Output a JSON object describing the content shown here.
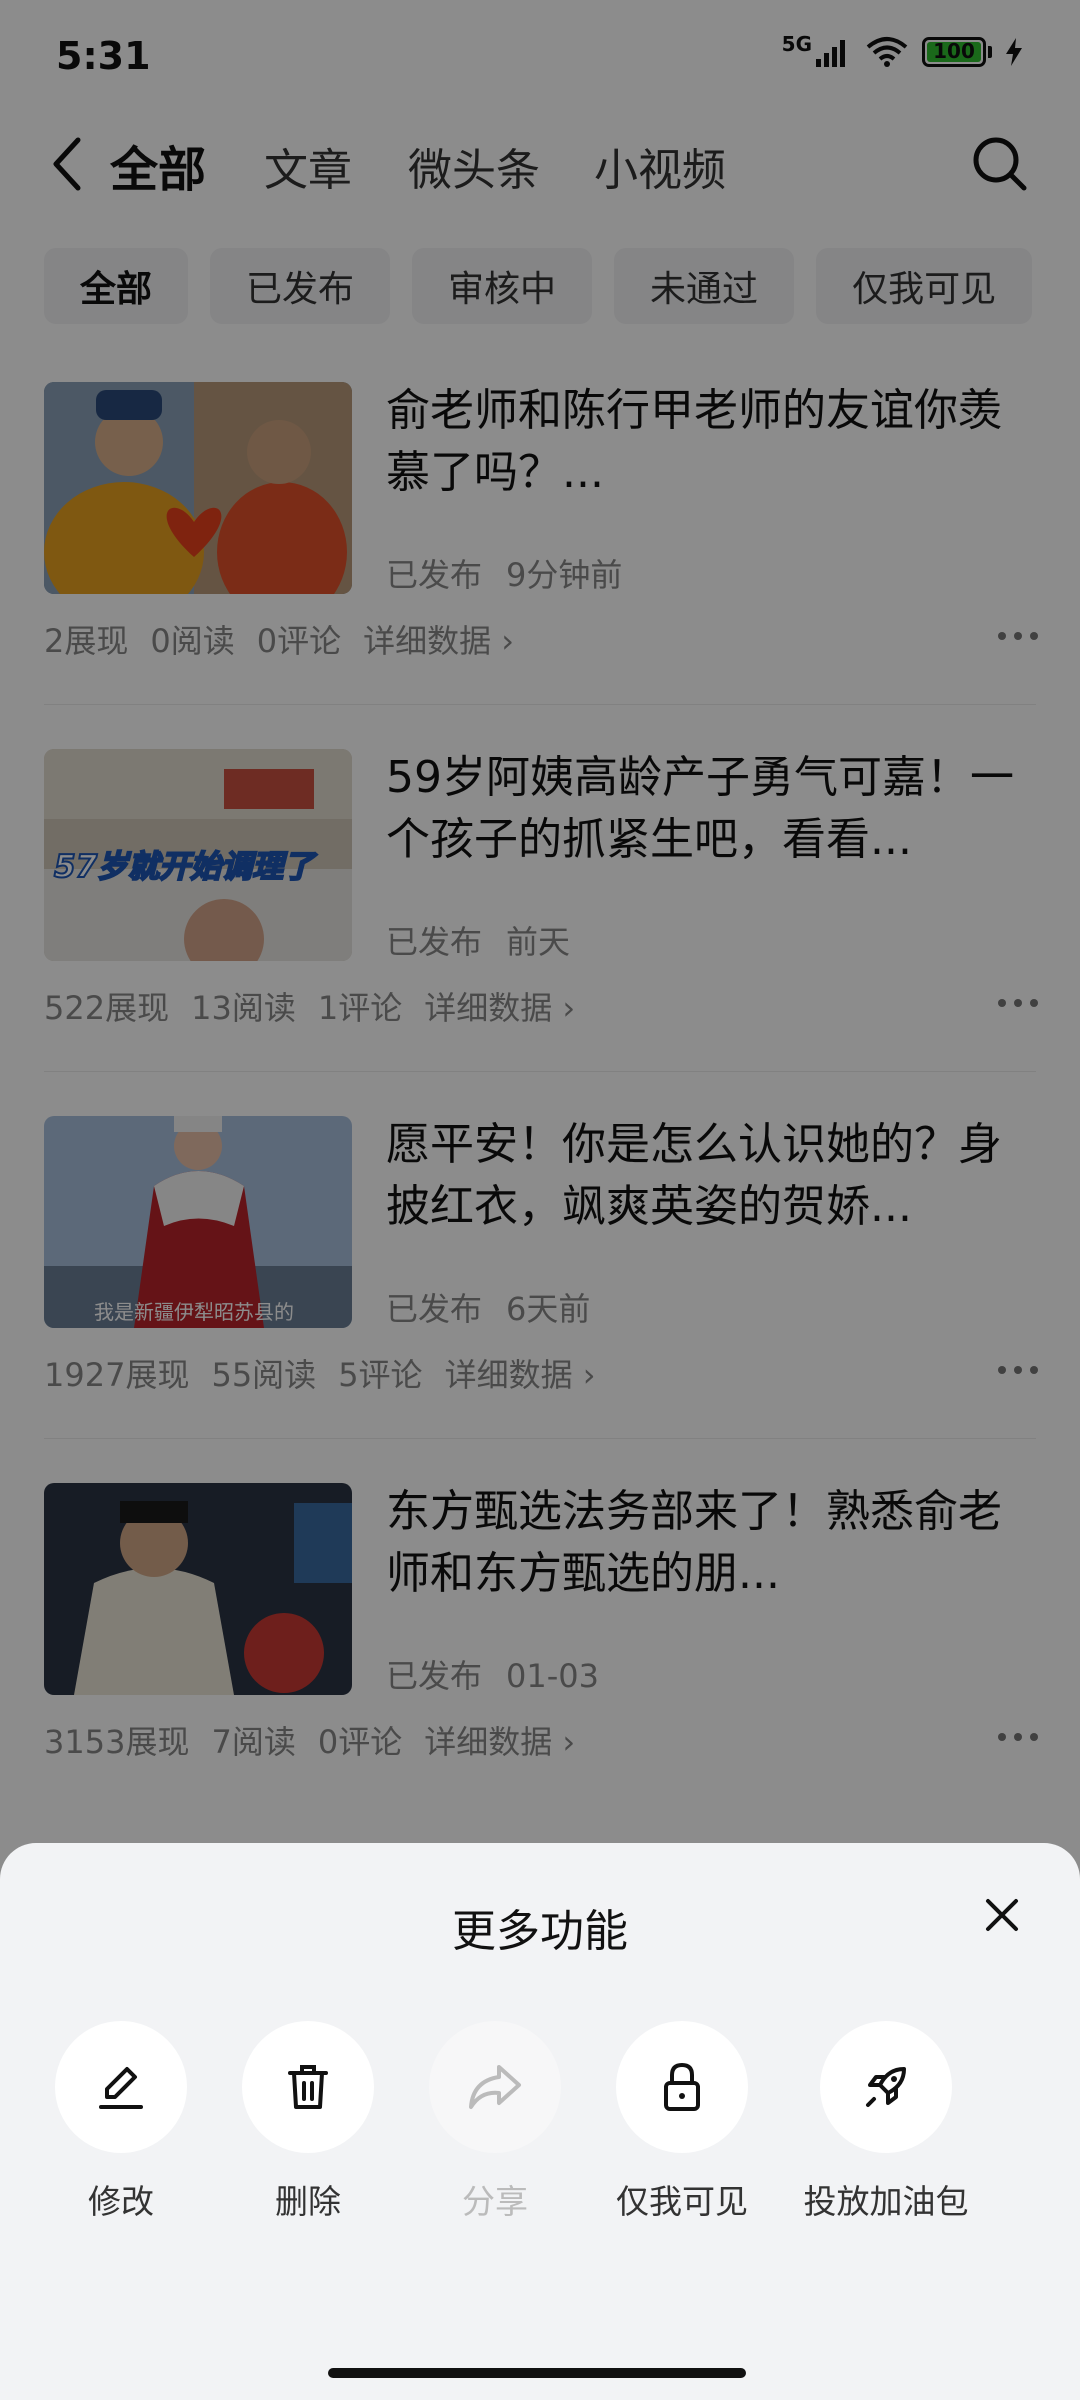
{
  "status": {
    "time": "5:31",
    "network": "5G",
    "battery": "100"
  },
  "nav": {
    "tabs": [
      {
        "label": "全部"
      },
      {
        "label": "文章"
      },
      {
        "label": "微头条"
      },
      {
        "label": "小视频"
      }
    ]
  },
  "filters": [
    "全部",
    "已发布",
    "审核中",
    "未通过",
    "仅我可见"
  ],
  "items": [
    {
      "title": "俞老师和陈行甲老师的友谊你羡慕了吗？...",
      "status": "已发布",
      "time": "9分钟前",
      "views": "2展现",
      "reads": "0阅读",
      "comments": "0评论",
      "detail": "详细数据 ›",
      "thumb_caption": ""
    },
    {
      "title": "59岁阿姨高龄产子勇气可嘉！一个孩子的抓紧生吧，看看...",
      "status": "已发布",
      "time": "前天",
      "views": "522展现",
      "reads": "13阅读",
      "comments": "1评论",
      "detail": "详细数据 ›",
      "thumb_caption": "57岁就开始调理了"
    },
    {
      "title": "愿平安！你是怎么认识她的？身披红衣，飒爽英姿的贺娇...",
      "status": "已发布",
      "time": "6天前",
      "views": "1927展现",
      "reads": "55阅读",
      "comments": "5评论",
      "detail": "详细数据 ›",
      "thumb_caption": "我是新疆伊犁昭苏县的"
    },
    {
      "title": "东方甄选法务部来了！熟悉俞老师和东方甄选的朋...",
      "status": "已发布",
      "time": "01-03",
      "views": "3153展现",
      "reads": "7阅读",
      "comments": "0评论",
      "detail": "详细数据 ›",
      "thumb_caption": ""
    }
  ],
  "sheet": {
    "title": "更多功能",
    "actions": [
      {
        "label": "修改",
        "icon": "edit-icon"
      },
      {
        "label": "删除",
        "icon": "trash-icon"
      },
      {
        "label": "分享",
        "icon": "share-icon",
        "disabled": true
      },
      {
        "label": "仅我可见",
        "icon": "lock-icon"
      },
      {
        "label": "投放加油包",
        "icon": "rocket-icon"
      }
    ]
  }
}
